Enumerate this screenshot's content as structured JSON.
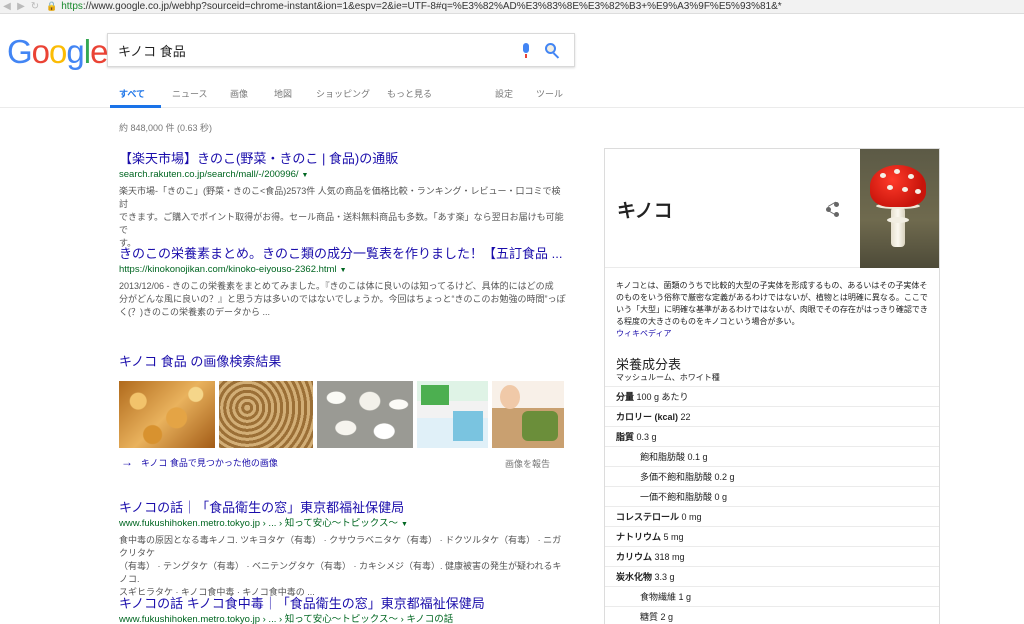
{
  "browser": {
    "url_scheme": "https",
    "url_rest": "://www.google.co.jp/webhp?sourceid=chrome-instant&ion=1&espv=2&ie=UTF-8#q=%E3%82%AD%E3%83%8E%E3%82%B3+%E9%A3%9F%E5%93%81&*"
  },
  "logo": {
    "letters": [
      "G",
      "o",
      "o",
      "g",
      "l",
      "e"
    ]
  },
  "search": {
    "query": "キノコ 食品"
  },
  "tabs": {
    "all": "すべて",
    "news": "ニュース",
    "images": "画像",
    "maps": "地図",
    "shopping": "ショッピング",
    "more": "もっと見る",
    "settings": "設定",
    "tools": "ツール"
  },
  "stats": "約 848,000 件 (0.63 秒)",
  "results": [
    {
      "title": "【楽天市場】きのこ(野菜・きのこ | 食品)の通販",
      "cite": "search.rakuten.co.jp/search/mall/-/200996/",
      "snippet_line1": "楽天市場-「きのこ」(野菜・きのこ<食品)2573件 人気の商品を価格比較・ランキング・レビュー・口コミで検討",
      "snippet_line2": "できます。ご購入でポイント取得がお得。セール商品・送料無料商品も多数。「あす楽」なら翌日お届けも可能で",
      "snippet_line3": "す。"
    },
    {
      "title": "きのこの栄養素まとめ。きのこ類の成分一覧表を作りました！【五訂食品 ...",
      "cite": "https://kinokonojikan.com/kinoko-eiyouso-2362.html",
      "snippet_line1": "2013/12/06 - きのこの栄養素をまとめてみました。『きのこは体に良いのは知ってるけど、具体的にはどの成",
      "snippet_line2": "分がどんな風に良いの？』と思う方は多いのではないでしょうか。今回はちょっと“きのこのお勉強の時間”っぽ",
      "snippet_line3": "く(？)きのこの栄養素のデータから ..."
    },
    {
      "title": "キノコの話｜「食品衛生の窓」東京都福祉保健局",
      "cite": "www.fukushihoken.metro.tokyo.jp › ... › 知って安心〜トピックス〜",
      "snippet_line1": "食中毒の原因となる毒キノコ. ツキヨタケ（有毒） · クサウラベニタケ（有毒） · ドクツルタケ（有毒） · ニガクリタケ",
      "snippet_line2": "（有毒） · テングタケ（有毒） · ベニテングタケ（有毒） · カキシメジ（有毒）. 健康被害の発生が疑われるキノコ.",
      "snippet_line3": "スギヒラタケ · キノコ食中毒 · キノコ食中毒の ..."
    },
    {
      "title": "キノコの話 キノコ食中毒｜「食品衛生の窓」東京都福祉保健局",
      "cite": "www.fukushihoken.metro.tokyo.jp › ... › 知って安心〜トピックス〜 › キノコの話"
    }
  ],
  "image_section": {
    "title": "キノコ 食品 の画像検索結果",
    "more": "キノコ 食品で見つかった他の画像",
    "report": "画像を報告"
  },
  "knowledge_panel": {
    "title": "キノコ",
    "description": "キノコとは、菌類のうちで比較的大型の子実体を形成するもの、あるいはその子実体そのものをいう俗称で厳密な定義があるわけではないが、植物とは明確に異なる。ここでいう「大型」に明確な基準があるわけではないが、肉眼でその存在がはっきり確認できる程度の大きさのものをキノコという場合が多い。",
    "source": "ウィキペディア",
    "nutrition_title": "栄養成分表",
    "nutrition_subtitle": "マッシュルーム、ホワイト種",
    "rows": [
      {
        "label": "分量",
        "value": "100 g あたり",
        "indent": false
      },
      {
        "label": "カロリー (kcal)",
        "value": "22",
        "indent": false
      },
      {
        "label": "脂質",
        "value": "0.3 g",
        "indent": false
      },
      {
        "label": "飽和脂肪酸",
        "value": "0.1 g",
        "indent": true
      },
      {
        "label": "多価不飽和脂肪酸",
        "value": "0.2 g",
        "indent": true
      },
      {
        "label": "一価不飽和脂肪酸",
        "value": "0 g",
        "indent": true
      },
      {
        "label": "コレステロール",
        "value": "0 mg",
        "indent": false
      },
      {
        "label": "ナトリウム",
        "value": "5 mg",
        "indent": false
      },
      {
        "label": "カリウム",
        "value": "318 mg",
        "indent": false
      },
      {
        "label": "炭水化物",
        "value": "3.3 g",
        "indent": false
      },
      {
        "label": "食物繊維",
        "value": "1 g",
        "indent": true
      },
      {
        "label": "糖質",
        "value": "2 g",
        "indent": true
      }
    ]
  },
  "colors": {
    "link": "#1a0dab",
    "cite": "#006621",
    "accent": "#1a73e8"
  },
  "icons": [
    "back-icon",
    "forward-icon",
    "lock-icon",
    "mic-icon",
    "search-icon",
    "share-icon",
    "arrow-right-icon"
  ]
}
